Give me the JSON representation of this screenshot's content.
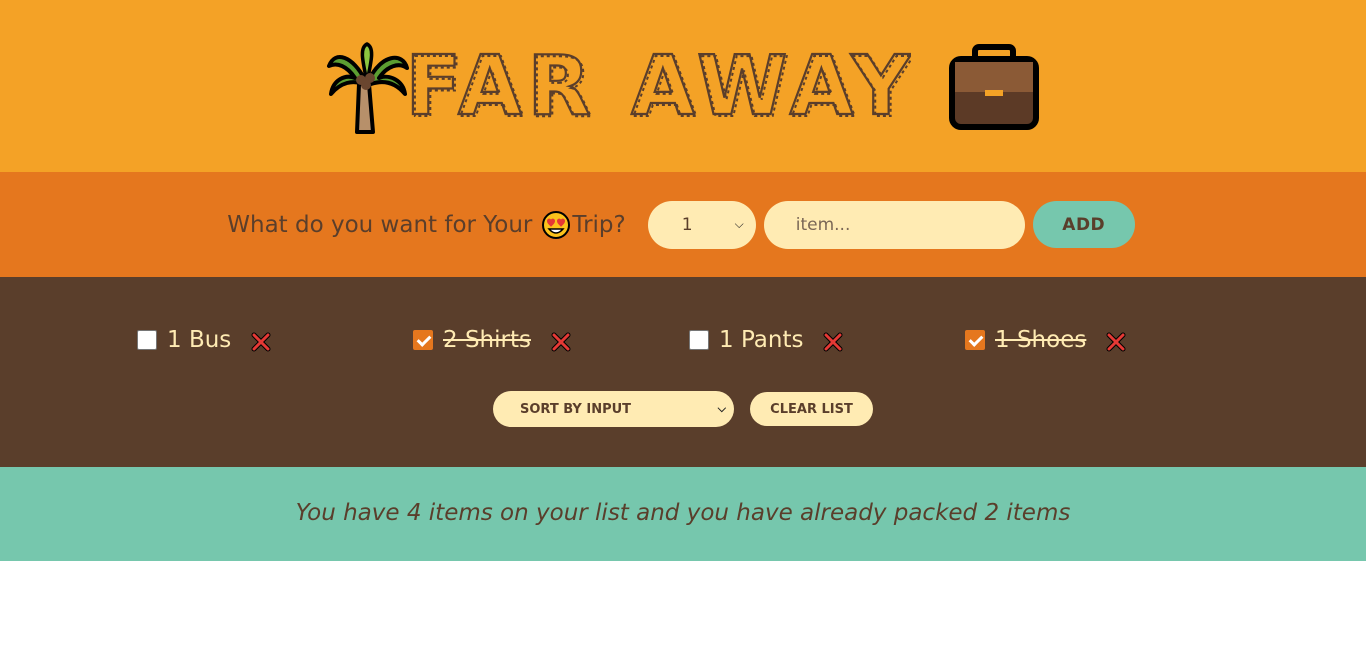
{
  "header": {
    "title": "FAR AWAY",
    "left_icon": "palm-tree-icon",
    "right_icon": "briefcase-icon"
  },
  "form": {
    "question_prefix": "What do you want for Your",
    "question_emoji": "heart-eyes-emoji-icon",
    "question_suffix": "Trip?",
    "quantity_value": "1",
    "item_placeholder": "item...",
    "add_label": "ADD"
  },
  "list": {
    "items": [
      {
        "label": "1 Bus",
        "packed": false
      },
      {
        "label": "2 Shirts",
        "packed": true
      },
      {
        "label": "1 Pants",
        "packed": false
      },
      {
        "label": "1 Shoes",
        "packed": true
      }
    ],
    "sort_label": "SORT BY INPUT",
    "clear_label": "CLEAR LIST"
  },
  "stats": {
    "text": "You have 4 items on your list and you have already packed 2 items"
  },
  "colors": {
    "header_bg": "#f4a226",
    "form_bg": "#e5771e",
    "list_bg": "#5a3e2b",
    "stats_bg": "#76c7ad",
    "cream": "#ffebb3",
    "brown": "#5a3e2b"
  }
}
